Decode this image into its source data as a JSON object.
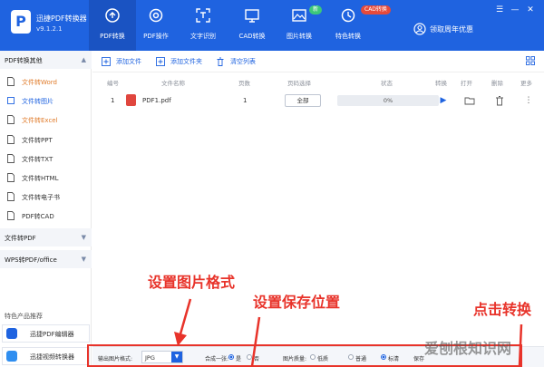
{
  "app": {
    "name": "迅捷PDF转换器",
    "version": "v9.1.2.1"
  },
  "nav": {
    "tabs": [
      {
        "label": "PDF转换",
        "icon": "convert-icon",
        "active": true
      },
      {
        "label": "PDF操作",
        "icon": "gear-icon"
      },
      {
        "label": "文字识别",
        "icon": "ocr-icon"
      },
      {
        "label": "CAD转换",
        "icon": "cad-icon"
      },
      {
        "label": "图片转换",
        "icon": "image-icon"
      },
      {
        "label": "特色转换",
        "icon": "feature-icon"
      }
    ],
    "badge_new": "新",
    "badge_cad": "CAD转换"
  },
  "promo": {
    "label": "领取周年优惠",
    "icon": "user-circle-icon"
  },
  "window": {
    "skin": "☰",
    "minimize": "—",
    "close": "✕"
  },
  "sidebar": {
    "section1": "PDF转换其他",
    "items": [
      {
        "label": "文件转Word",
        "style": "orange"
      },
      {
        "label": "文件转图片",
        "style": "active"
      },
      {
        "label": "文件转Excel",
        "style": "orange"
      },
      {
        "label": "文件转PPT"
      },
      {
        "label": "文件转TXT"
      },
      {
        "label": "文件转HTML"
      },
      {
        "label": "文件转电子书"
      },
      {
        "label": "PDF转CAD"
      }
    ],
    "section2": "文件转PDF",
    "section3": "WPS转PDF/office",
    "featured_title": "特色产品推荐",
    "products": [
      {
        "label": "迅捷PDF编辑器",
        "color": "#1f63e0"
      },
      {
        "label": "迅捷视频转换器",
        "color": "#2f8ef0"
      }
    ]
  },
  "toolbar": {
    "add_file": "添加文件",
    "add_folder": "添加文件夹",
    "clear_list": "清空列表"
  },
  "table": {
    "headers": [
      "编号",
      "文件名称",
      "页数",
      "页码选择",
      "状态",
      "转换",
      "打开",
      "删除",
      "更多"
    ],
    "rows": [
      {
        "num": "1",
        "name": "PDF1.pdf",
        "pages": "1",
        "range": "全部",
        "progress": 0,
        "status": "0%"
      }
    ]
  },
  "bottom": {
    "format_label": "输出图片格式:",
    "format_value": "JPG",
    "per_page_label": "合成一张:",
    "yes": "是",
    "no": "否",
    "quality_label": "图片质量:",
    "quality_low": "低质",
    "quality_mid": "普通",
    "quality_high": "标清",
    "save_label": "保存"
  },
  "annotations": {
    "format": "设置图片格式",
    "save": "设置保存位置",
    "convert": "点击转换"
  },
  "watermark": "爱刨根知识网",
  "colors": {
    "brand": "#1f63e0",
    "annotation": "#e8332a",
    "pdf": "#e0463e"
  }
}
